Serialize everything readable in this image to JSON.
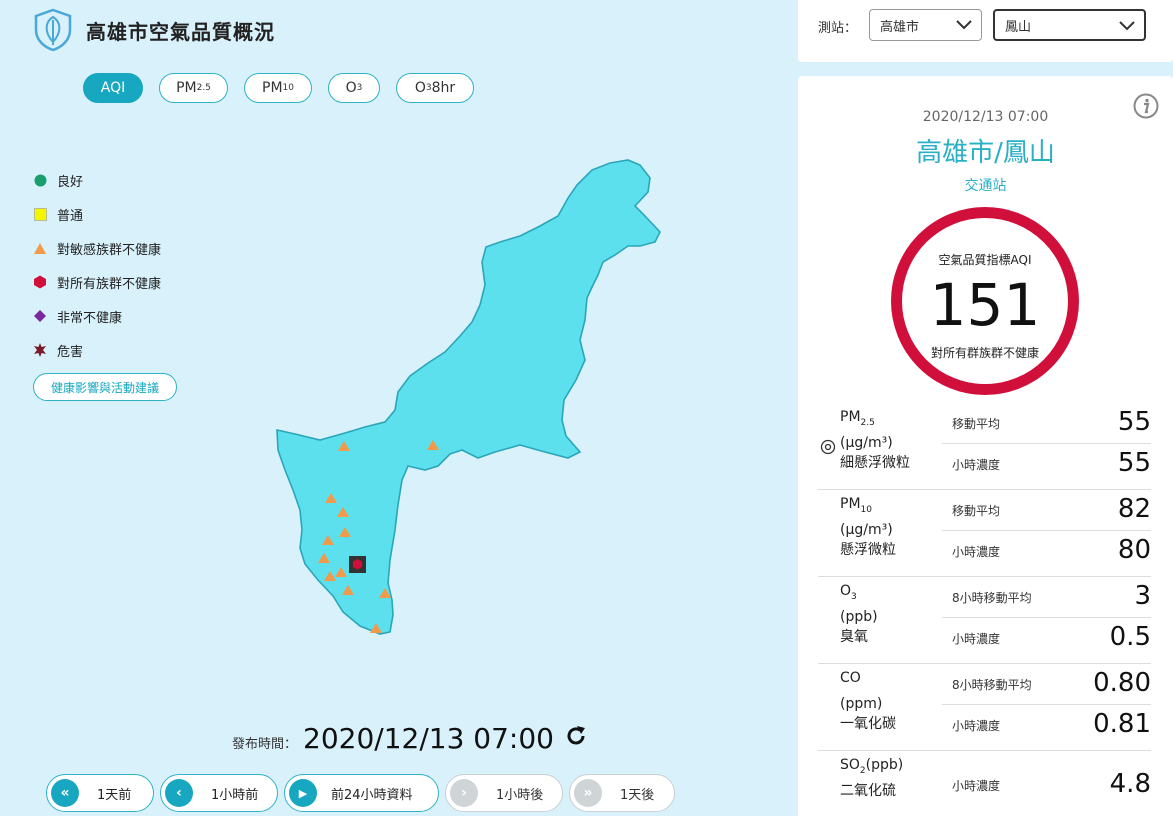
{
  "header": {
    "title": "高雄市空氣品質概況",
    "logo_icon": "leaf-shield-icon"
  },
  "tabs": [
    {
      "label": "AQI",
      "active": true
    },
    {
      "label": "PM",
      "sub": "2.5",
      "active": false
    },
    {
      "label": "PM",
      "sub": "10",
      "active": false
    },
    {
      "label": "O",
      "sub": "3",
      "active": false
    },
    {
      "label": "O",
      "sub": "3",
      "suffix": " 8hr",
      "active": false
    }
  ],
  "legend": {
    "items": [
      {
        "label": "良好",
        "icon": "circle-icon",
        "color": "#1a9e6e"
      },
      {
        "label": "普通",
        "icon": "square-icon",
        "color": "#f5f500"
      },
      {
        "label": "對敏感族群不健康",
        "icon": "triangle-icon",
        "color": "#f2994a"
      },
      {
        "label": "對所有族群不健康",
        "icon": "hexagon-icon",
        "color": "#d10f3b"
      },
      {
        "label": "非常不健康",
        "icon": "diamond-icon",
        "color": "#7a2a9e"
      },
      {
        "label": "危害",
        "icon": "star-icon",
        "color": "#7a1a2a"
      }
    ],
    "advice_button": "健康影響與活動建議"
  },
  "map": {
    "region_color": "#5ce0ed",
    "marker_status": [
      "對敏感族群不健康",
      "對所有族群不健康"
    ]
  },
  "publish": {
    "label": "發布時間：",
    "time": "2020/12/13 07:00"
  },
  "nav": [
    {
      "label": "1天前",
      "icon": "double-chevron-left-icon",
      "glyph": "«",
      "enabled": true
    },
    {
      "label": "1小時前",
      "icon": "chevron-left-icon",
      "glyph": "‹",
      "enabled": true
    },
    {
      "label": "前24小時資料",
      "icon": "play-icon",
      "glyph": "▶",
      "enabled": true
    },
    {
      "label": "1小時後",
      "icon": "chevron-right-icon",
      "glyph": "›",
      "enabled": false
    },
    {
      "label": "1天後",
      "icon": "double-chevron-right-icon",
      "glyph": "»",
      "enabled": false
    }
  ],
  "selector": {
    "label": "測站：",
    "city": "高雄市",
    "station": "鳳山"
  },
  "station_info": {
    "datetime": "2020/12/13 07:00",
    "name": "高雄市/鳳山",
    "type": "交通站",
    "aqi_label": "空氣品質指標AQI",
    "aqi_value": "151",
    "aqi_status": "對所有群族群不健康",
    "aqi_color": "#d10f3b"
  },
  "pollutants": [
    {
      "name_main": "PM",
      "name_sub": "2.5",
      "unit": "(μg/m³)",
      "desc": "細懸浮微粒",
      "r1_label": "移動平均",
      "r1_value": "55",
      "r2_label": "小時濃度",
      "r2_value": "55",
      "has_target": true
    },
    {
      "name_main": "PM",
      "name_sub": "10",
      "unit": "(μg/m³)",
      "desc": "懸浮微粒",
      "r1_label": "移動平均",
      "r1_value": "82",
      "r2_label": "小時濃度",
      "r2_value": "80",
      "has_target": false
    },
    {
      "name_main": "O",
      "name_sub": "3",
      "unit": "(ppb)",
      "desc": "臭氧",
      "r1_label": "8小時移動平均",
      "r1_value": "3",
      "r2_label": "小時濃度",
      "r2_value": "0.5",
      "has_target": false
    },
    {
      "name_main": "CO",
      "name_sub": "",
      "unit": "(ppm)",
      "desc": "一氧化碳",
      "r1_label": "8小時移動平均",
      "r1_value": "0.80",
      "r2_label": "小時濃度",
      "r2_value": "0.81",
      "has_target": false
    },
    {
      "name_main": "SO",
      "name_sub": "2",
      "unit": "(ppb)",
      "desc": "二氧化硫",
      "r1_label": "",
      "r1_value": "",
      "r2_label": "小時濃度",
      "r2_value": "4.8",
      "has_target": false
    }
  ]
}
